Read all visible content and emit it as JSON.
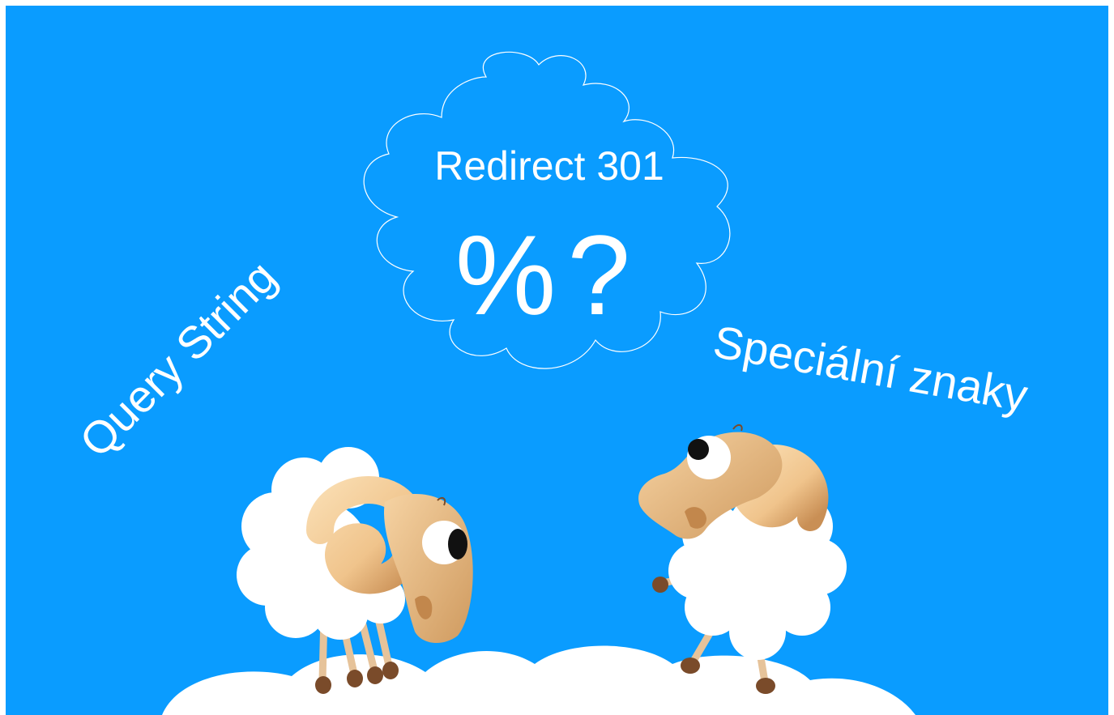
{
  "texts": {
    "cloud_title": "Redirect 301",
    "cloud_symbols": "%?",
    "left_label": "Query String",
    "right_label": "Speciální znaky"
  },
  "colors": {
    "sky": "#0a9cff",
    "cloud_fill": "#ffffff",
    "horn": "#f3c995",
    "horn_shade": "#d7a870",
    "leg": "#e6c39a",
    "hoof": "#7a4b2a",
    "eye_pupil": "#111111"
  },
  "icons": {
    "thought_bubble": "thought-cloud-icon",
    "sheep_left": "sheep-icon",
    "sheep_right": "sheep-icon",
    "ground": "cloud-ground-icon"
  }
}
